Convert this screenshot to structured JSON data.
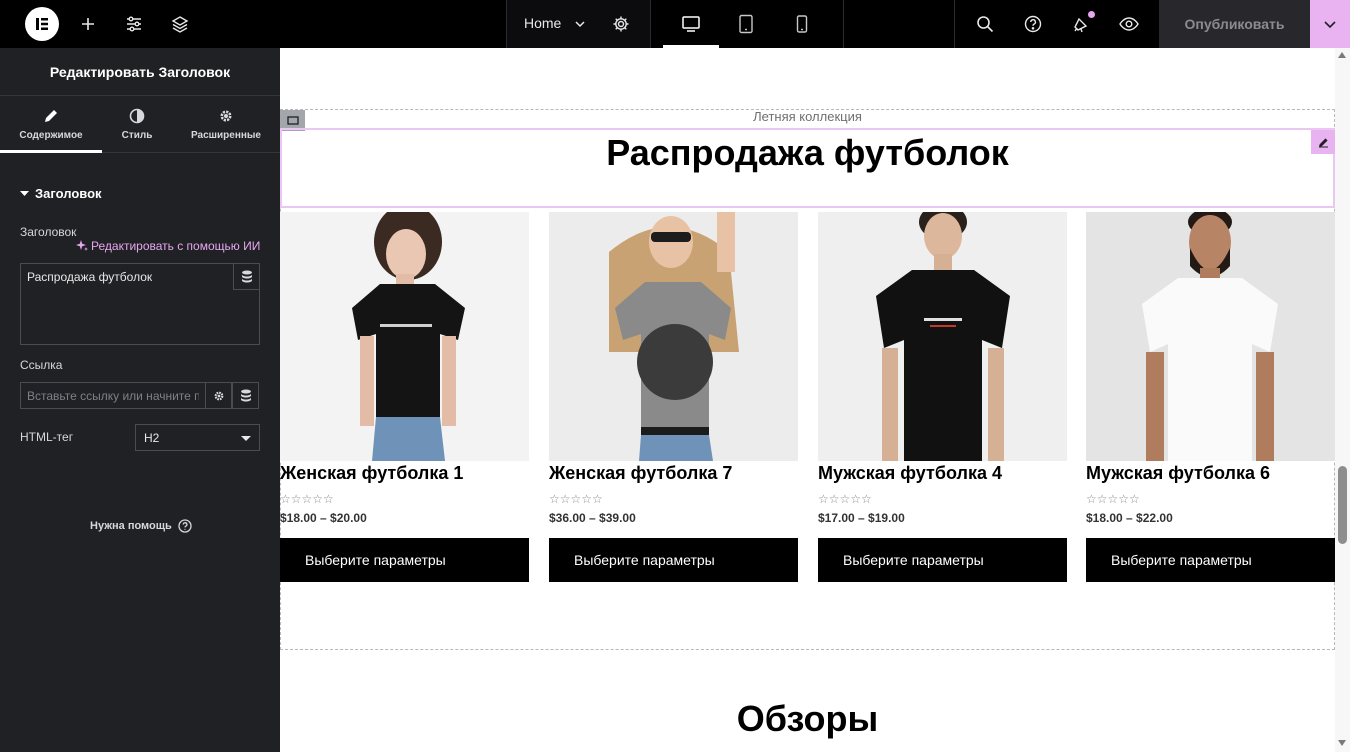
{
  "topbar": {
    "icons": [
      "elementor-logo-icon",
      "add-icon",
      "settings-sliders-icon",
      "layers-icon",
      "chevron-down-icon",
      "gear-icon",
      "desktop-icon",
      "tablet-icon",
      "mobile-icon",
      "search-icon",
      "help-icon",
      "notifications-icon",
      "preview-eye-icon"
    ],
    "page_name": "Home",
    "publish_label": "Опубликовать",
    "accent_color": "#e8b3f0"
  },
  "panel": {
    "title": "Редактировать Заголовок",
    "tabs": [
      {
        "label": "Содержимое",
        "icon": "pencil-icon"
      },
      {
        "label": "Стиль",
        "icon": "contrast-icon"
      },
      {
        "label": "Расширенные",
        "icon": "gear-icon"
      }
    ],
    "section_title": "Заголовок",
    "heading_label": "Заголовок",
    "ai_link": "Редактировать с помощью ИИ",
    "heading_value": "Распродажа футболок",
    "link_label": "Ссылка",
    "link_placeholder": "Вставьте ссылку или начните п",
    "html_tag_label": "HTML-тег",
    "html_tag_value": "H2",
    "help_label": "Нужна помощь"
  },
  "canvas": {
    "subtitle": "Летняя коллекция",
    "heading": "Распродажа футболок",
    "products": [
      {
        "name": "Женская футболка 1",
        "rating": "☆☆☆☆☆",
        "price": "$18.00 – $20.00",
        "button": "Выберите параметры"
      },
      {
        "name": "Женская футболка 7",
        "rating": "☆☆☆☆☆",
        "price": "$36.00 – $39.00",
        "button": "Выберите параметры"
      },
      {
        "name": "Мужская футболка 4",
        "rating": "☆☆☆☆☆",
        "price": "$17.00 – $19.00",
        "button": "Выберите параметры"
      },
      {
        "name": "Мужская футболка 6",
        "rating": "☆☆☆☆☆",
        "price": "$18.00 – $22.00",
        "button": "Выберите параметры"
      }
    ],
    "next_heading": "Обзоры"
  }
}
